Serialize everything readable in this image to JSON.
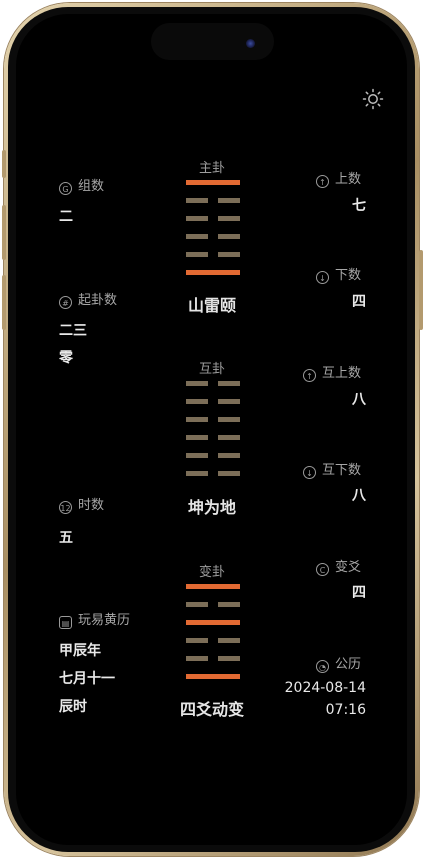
{
  "left": {
    "group_label": "组数",
    "group_value": "二",
    "qigua_label": "起卦数",
    "qigua_values": [
      "二三",
      "零"
    ],
    "shi_label": "时数",
    "shi_value": "五",
    "almanac_label": "玩易黄历",
    "almanac_values": [
      "甲辰年",
      "七月十一",
      "辰时"
    ]
  },
  "center": {
    "main_title": "主卦",
    "main_name": "山雷颐",
    "main_lines": [
      "yang",
      "yin",
      "yin",
      "yin",
      "yin",
      "yang"
    ],
    "hu_title": "互卦",
    "hu_name": "坤为地",
    "hu_lines": [
      "yin",
      "yin",
      "yin",
      "yin",
      "yin",
      "yin"
    ],
    "bian_title": "变卦",
    "bian_name": "四爻动变",
    "bian_lines": [
      "yang",
      "yin",
      "yang",
      "yin",
      "yin",
      "yang"
    ]
  },
  "right": {
    "upper_label": "上数",
    "upper_value": "七",
    "lower_label": "下数",
    "lower_value": "四",
    "hu_upper_label": "互上数",
    "hu_upper_value": "八",
    "hu_lower_label": "互下数",
    "hu_lower_value": "八",
    "change_label": "变爻",
    "change_value": "四",
    "gregorian_label": "公历",
    "date": "2024-08-14",
    "time": "07:16"
  },
  "colors": {
    "yang": "#e26a33",
    "yin": "#7c6e58"
  },
  "icons": {
    "settings": "sun-icon",
    "group": "g-circle-icon",
    "qigua": "hash-circle-icon",
    "shi": "twelve-circle-icon",
    "almanac": "calendar-icon",
    "upper": "arrow-up-circle-icon",
    "lower": "arrow-down-circle-icon",
    "change": "c-circle-icon",
    "gregorian": "clock-icon"
  }
}
